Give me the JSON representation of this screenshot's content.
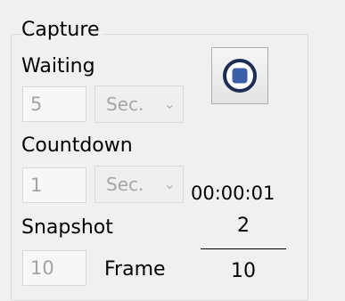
{
  "capture": {
    "group_title": "Capture",
    "waiting": {
      "label": "Waiting",
      "value": "5",
      "unit": "Sec."
    },
    "countdown": {
      "label": "Countdown",
      "value": "1",
      "unit": "Sec."
    },
    "snapshot": {
      "label": "Snapshot",
      "value": "10",
      "frame_label": "Frame"
    },
    "timer": "00:00:01",
    "counter": {
      "current": "2",
      "total": "10"
    },
    "stop_button": {
      "icon": "stop-icon",
      "accent": "#3b5fa8",
      "ring": "#1d2c54"
    }
  }
}
